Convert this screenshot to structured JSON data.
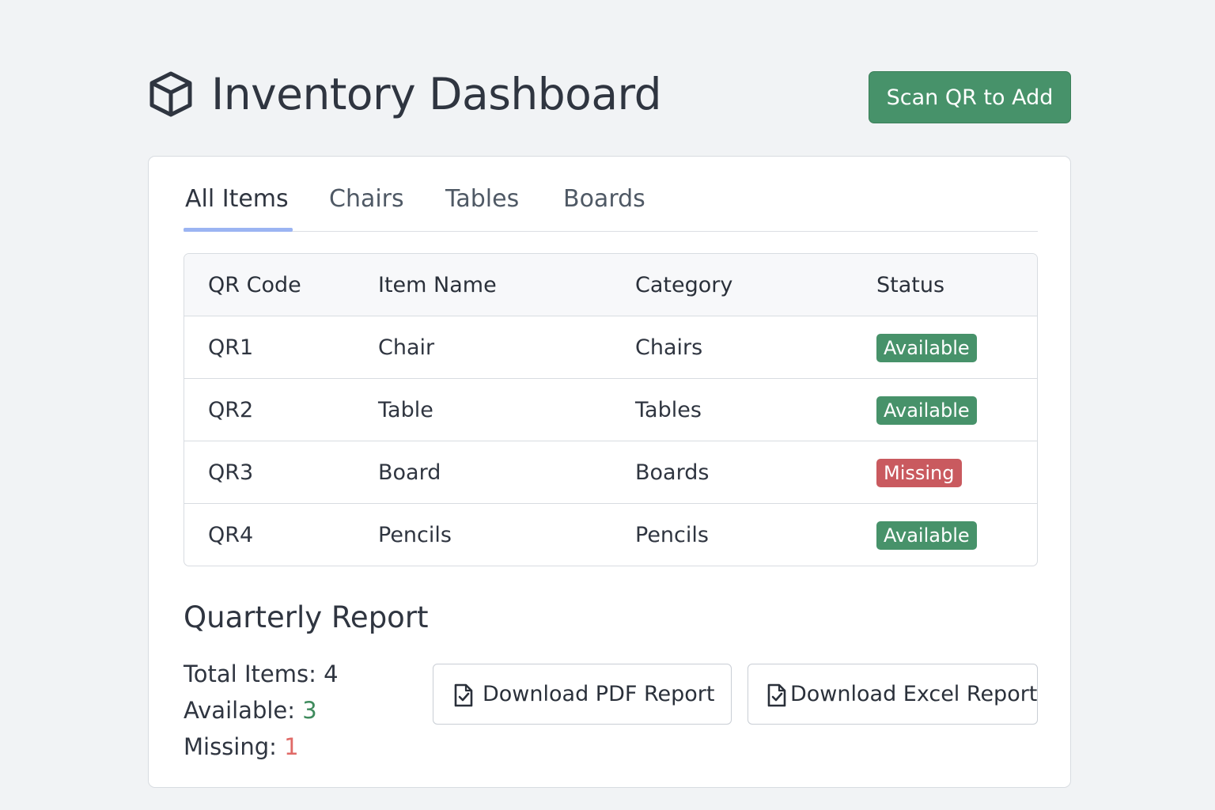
{
  "header": {
    "title": "Inventory Dashboard",
    "logo_icon": "cube-icon",
    "scan_button_label": "Scan QR to Add"
  },
  "tabs": [
    {
      "label": "All Items",
      "active": true
    },
    {
      "label": "Chairs",
      "active": false
    },
    {
      "label": "Tables",
      "active": false
    },
    {
      "label": "Boards",
      "active": false
    }
  ],
  "table": {
    "headers": [
      "QR Code",
      "Item Name",
      "Category",
      "Status"
    ],
    "rows": [
      {
        "qr": "QR1",
        "name": "Chair",
        "category": "Chairs",
        "status": "Available"
      },
      {
        "qr": "QR2",
        "name": "Table",
        "category": "Tables",
        "status": "Available"
      },
      {
        "qr": "QR3",
        "name": "Board",
        "category": "Boards",
        "status": "Missing"
      },
      {
        "qr": "QR4",
        "name": "Pencils",
        "category": "Pencils",
        "status": "Available"
      }
    ]
  },
  "report": {
    "title": "Quarterly Report",
    "total_label": "Total Items: ",
    "total_value": "4",
    "available_label": "Available: ",
    "available_value": "3",
    "missing_label": "Missing: ",
    "missing_value": "1",
    "pdf_button_label": "Download PDF Report",
    "excel_button_label": "Download Excel Report",
    "download_icon": "document-check-icon"
  },
  "colors": {
    "accent_green": "#47926a",
    "missing_red": "#c95a5f",
    "tab_underline": "#9bb4f2",
    "background": "#f1f3f5"
  }
}
